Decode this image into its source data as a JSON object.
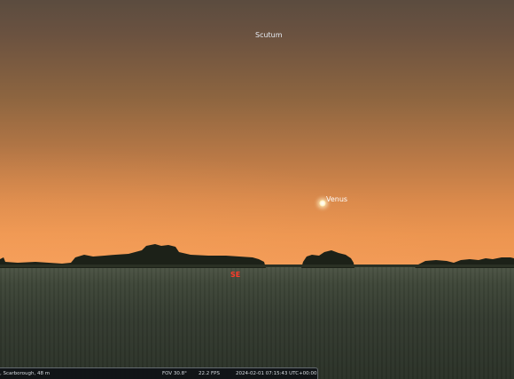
{
  "sky": {
    "constellation_label": "Scutum",
    "planet_label": "Venus",
    "cardinal_direction": "SE",
    "cardinal_color": "#ff3b2a"
  },
  "status_bar": {
    "location": ", Scarborough, 48 m",
    "fov": "FOV 30.8°",
    "fps": "22.2 FPS",
    "datetime": "2024-02-01 07:15:43 UTC+00:00"
  }
}
